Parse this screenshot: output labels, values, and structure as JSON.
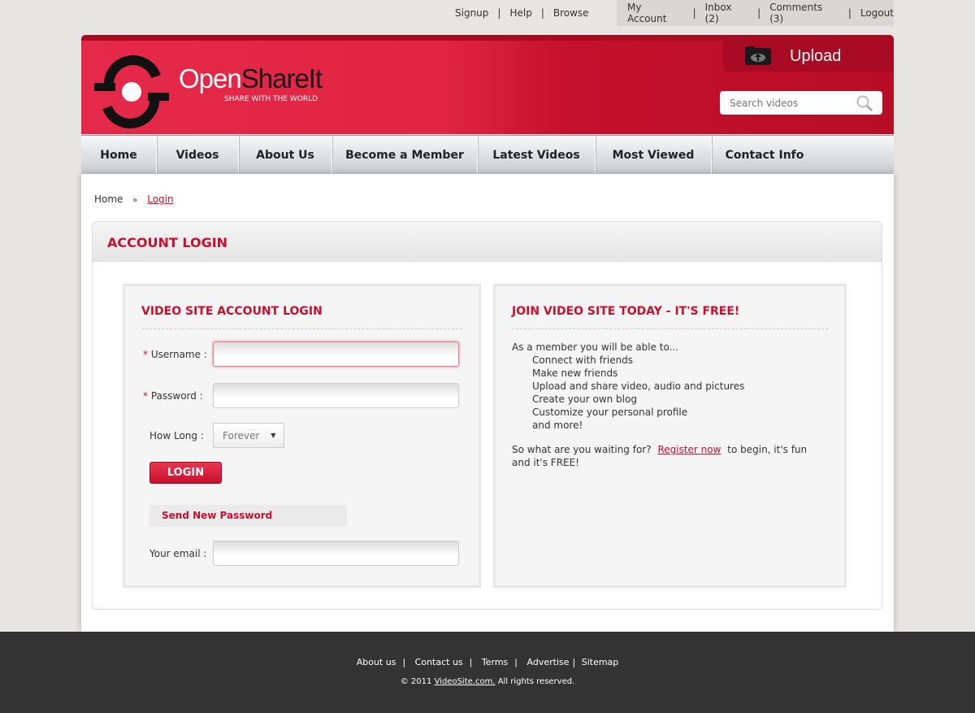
{
  "top_links": [
    "Signup",
    "Help",
    "Browse"
  ],
  "account_links": [
    "My Account",
    "Inbox (2)",
    "Comments (3)",
    "Logout"
  ],
  "logo": {
    "part1": "Open",
    "part2": "ShareIt",
    "tagline": "SHARE WITH THE WORLD"
  },
  "upload_label": "Upload",
  "search_placeholder": "Search videos",
  "nav": [
    "Home",
    "Videos",
    "About Us",
    "Become a Member",
    "Latest Videos",
    "Most Viewed",
    "Contact Info"
  ],
  "breadcrumb": {
    "home": "Home",
    "sep": "»",
    "current": "Login"
  },
  "panel_title": "ACCOUNT LOGIN",
  "login": {
    "title": "VIDEO SITE ACCOUNT LOGIN",
    "req": "*",
    "username_label": "Username :",
    "password_label": "Password :",
    "howlong_label": "How Long :",
    "howlong_value": "Forever",
    "login_button": "LOGIN",
    "send_pw": "Send New Password",
    "email_label": "Your email :"
  },
  "join": {
    "title": "JOIN VIDEO SITE TODAY - IT'S FREE!",
    "intro": "As a member you will be able to...",
    "items": [
      "Connect with friends",
      "Make new friends",
      "Upload and share video, audio and pictures",
      "Create your own blog",
      "Customize your personal profile",
      "and more!"
    ],
    "cta_pre": "So what are you waiting for?",
    "cta_link": "Register now",
    "cta_post": "to begin, it's fun and it's FREE!"
  },
  "footer": {
    "links": [
      "About us",
      "Contact us",
      "Terms",
      "Advertise",
      "Sitemap"
    ],
    "copy_pre": "© 2011",
    "copy_link": "VideoSite.com.",
    "copy_post": "All rights reserved."
  }
}
